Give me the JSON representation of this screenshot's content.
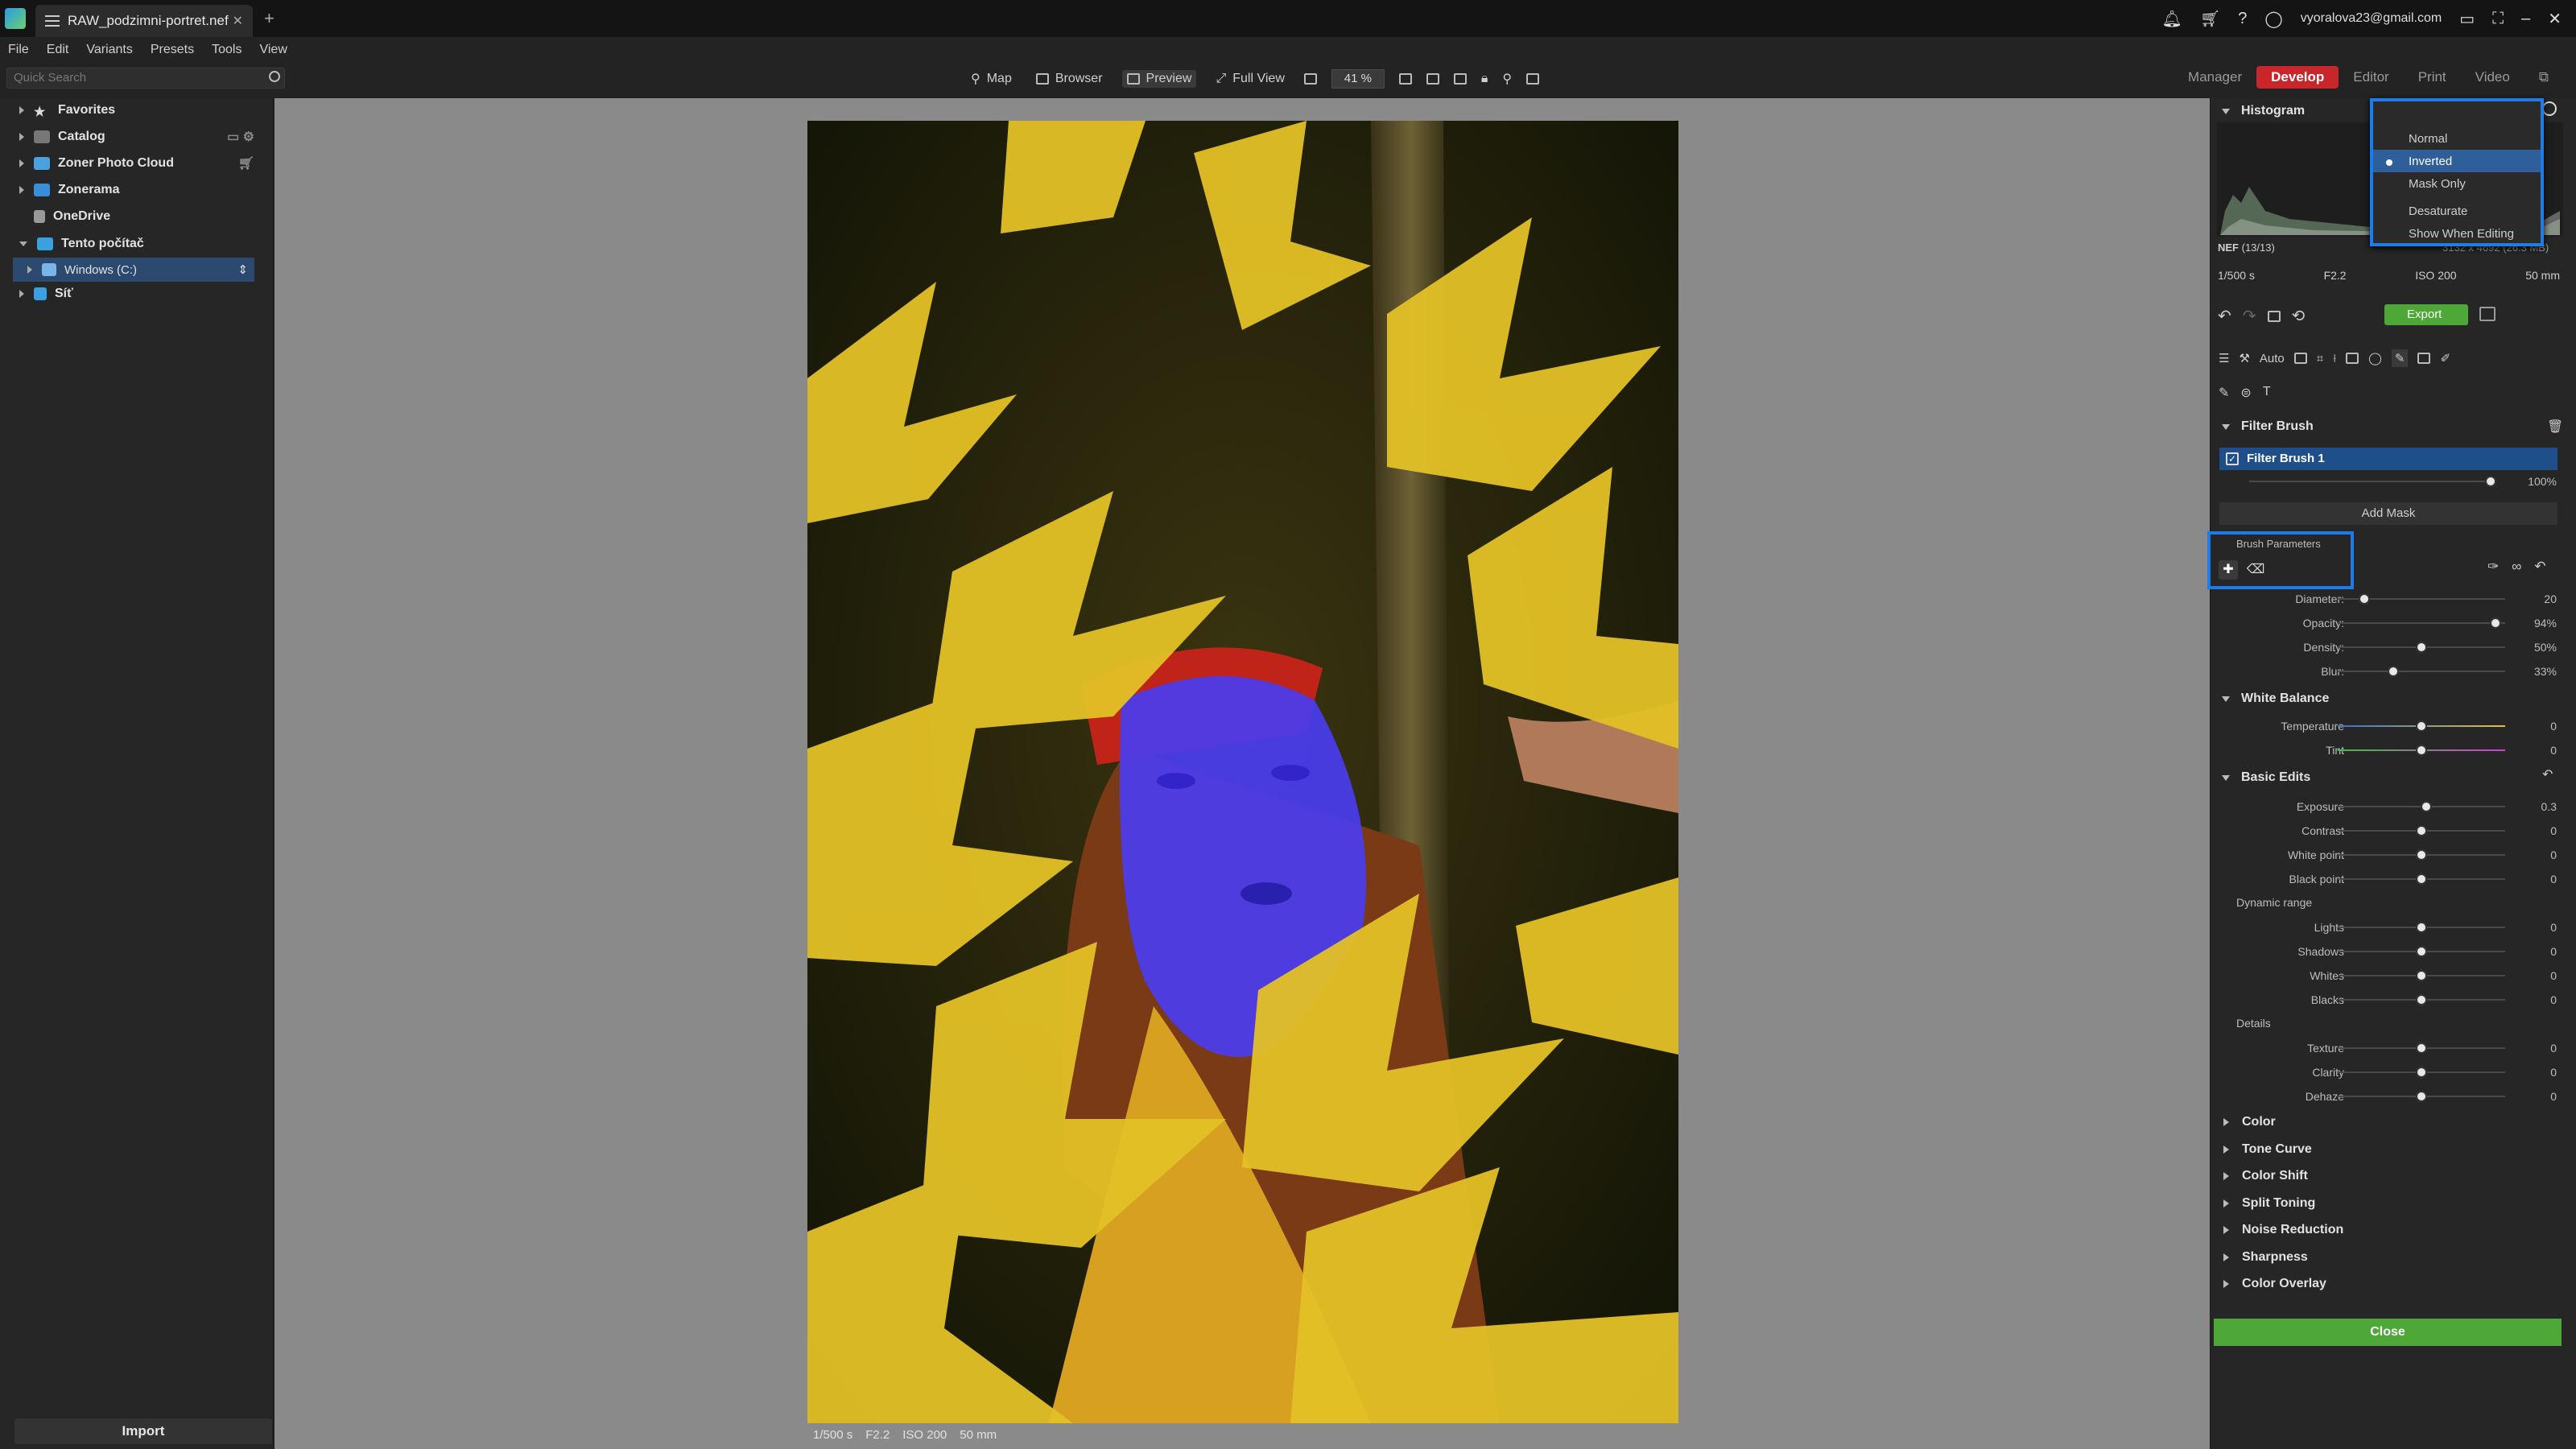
{
  "titlebar": {
    "doc_tab": "RAW_podzimni-portret.nef",
    "account": "vyoralova23@gmail.com"
  },
  "menu": [
    "File",
    "Edit",
    "Variants",
    "Presets",
    "Tools",
    "View"
  ],
  "search": {
    "placeholder": "Quick Search"
  },
  "view_tools": {
    "map": "Map",
    "browser": "Browser",
    "preview": "Preview",
    "full_view": "Full View",
    "zoom": "41 %"
  },
  "modes": [
    "Manager",
    "Develop",
    "Editor",
    "Print",
    "Video"
  ],
  "modes_active": "Develop",
  "sidebar": {
    "items": [
      {
        "label": "Favorites"
      },
      {
        "label": "Catalog"
      },
      {
        "label": "Zoner Photo Cloud"
      },
      {
        "label": "Zonerama"
      },
      {
        "label": "OneDrive"
      },
      {
        "label": "Tento počítač"
      },
      {
        "label": "Windows (C:)"
      },
      {
        "label": "Síť"
      }
    ],
    "import_label": "Import"
  },
  "photo_info": {
    "shutter": "1/500 s",
    "aperture": "F2.2",
    "iso": "ISO 200",
    "focal": "50 mm"
  },
  "histogram": {
    "title": "Histogram",
    "format": "NEF",
    "count": "(13/13)",
    "dims": "3132 x 4692 (26.3 MB)",
    "shutter": "1/500 s",
    "aperture": "F2.2",
    "iso": "ISO 200",
    "focal": "50 mm"
  },
  "dropdown": {
    "items": [
      "Normal",
      "Inverted",
      "Mask Only",
      "Desaturate",
      "Show When Editing"
    ],
    "selected": "Inverted"
  },
  "tools": {
    "export": "Export",
    "auto": "Auto"
  },
  "filter_brush": {
    "title": "Filter Brush",
    "item_label": "Filter Brush 1",
    "strength": "100%",
    "strength_value": 100,
    "add_mask": "Add Mask",
    "brush_params": "Brush Parameters"
  },
  "brush_sliders": [
    {
      "label": "Diameter:",
      "value": "20",
      "pos": 0.16
    },
    {
      "label": "Opacity:",
      "value": "94%",
      "pos": 0.94
    },
    {
      "label": "Density:",
      "value": "50%",
      "pos": 0.5
    },
    {
      "label": "Blur:",
      "value": "33%",
      "pos": 0.33
    }
  ],
  "white_balance": {
    "title": "White Balance",
    "sliders": [
      {
        "label": "Temperature",
        "value": "0",
        "pos": 0.5
      },
      {
        "label": "Tint",
        "value": "0",
        "pos": 0.5
      }
    ]
  },
  "basic_edits": {
    "title": "Basic Edits",
    "sliders": [
      {
        "label": "Exposure",
        "value": "0.3",
        "pos": 0.53
      },
      {
        "label": "Contrast",
        "value": "0",
        "pos": 0.5
      },
      {
        "label": "White point",
        "value": "0",
        "pos": 0.5
      },
      {
        "label": "Black point",
        "value": "0",
        "pos": 0.5
      }
    ],
    "dynamic_range": "Dynamic range",
    "dr_sliders": [
      {
        "label": "Lights",
        "value": "0",
        "pos": 0.5
      },
      {
        "label": "Shadows",
        "value": "0",
        "pos": 0.5
      },
      {
        "label": "Whites",
        "value": "0",
        "pos": 0.5
      },
      {
        "label": "Blacks",
        "value": "0",
        "pos": 0.5
      }
    ],
    "details": "Details",
    "details_sliders": [
      {
        "label": "Texture",
        "value": "0",
        "pos": 0.5
      },
      {
        "label": "Clarity",
        "value": "0",
        "pos": 0.5
      },
      {
        "label": "Dehaze",
        "value": "0",
        "pos": 0.5
      }
    ]
  },
  "collapsed_sections": [
    "Color",
    "Tone Curve",
    "Color Shift",
    "Split Toning",
    "Noise Reduction",
    "Sharpness",
    "Color Overlay"
  ],
  "close_label": "Close",
  "colors": {
    "accent_red": "#c8262b",
    "selection_blue": "#1e7be8",
    "close_green": "#4da838",
    "mask_overlay": "#4a3df0"
  }
}
